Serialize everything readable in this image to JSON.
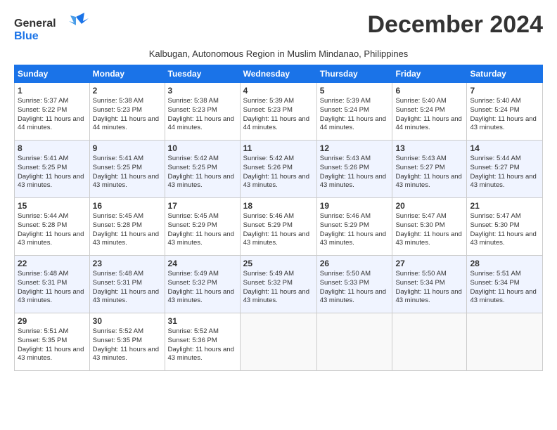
{
  "logo": {
    "line1": "General",
    "line2": "Blue"
  },
  "title": "December 2024",
  "location": "Kalbugan, Autonomous Region in Muslim Mindanao, Philippines",
  "weekdays": [
    "Sunday",
    "Monday",
    "Tuesday",
    "Wednesday",
    "Thursday",
    "Friday",
    "Saturday"
  ],
  "weeks": [
    [
      {
        "day": "1",
        "sunrise": "5:37 AM",
        "sunset": "5:22 PM",
        "daylight": "11 hours and 44 minutes."
      },
      {
        "day": "2",
        "sunrise": "5:38 AM",
        "sunset": "5:23 PM",
        "daylight": "11 hours and 44 minutes."
      },
      {
        "day": "3",
        "sunrise": "5:38 AM",
        "sunset": "5:23 PM",
        "daylight": "11 hours and 44 minutes."
      },
      {
        "day": "4",
        "sunrise": "5:39 AM",
        "sunset": "5:23 PM",
        "daylight": "11 hours and 44 minutes."
      },
      {
        "day": "5",
        "sunrise": "5:39 AM",
        "sunset": "5:24 PM",
        "daylight": "11 hours and 44 minutes."
      },
      {
        "day": "6",
        "sunrise": "5:40 AM",
        "sunset": "5:24 PM",
        "daylight": "11 hours and 44 minutes."
      },
      {
        "day": "7",
        "sunrise": "5:40 AM",
        "sunset": "5:24 PM",
        "daylight": "11 hours and 43 minutes."
      }
    ],
    [
      {
        "day": "8",
        "sunrise": "5:41 AM",
        "sunset": "5:25 PM",
        "daylight": "11 hours and 43 minutes."
      },
      {
        "day": "9",
        "sunrise": "5:41 AM",
        "sunset": "5:25 PM",
        "daylight": "11 hours and 43 minutes."
      },
      {
        "day": "10",
        "sunrise": "5:42 AM",
        "sunset": "5:25 PM",
        "daylight": "11 hours and 43 minutes."
      },
      {
        "day": "11",
        "sunrise": "5:42 AM",
        "sunset": "5:26 PM",
        "daylight": "11 hours and 43 minutes."
      },
      {
        "day": "12",
        "sunrise": "5:43 AM",
        "sunset": "5:26 PM",
        "daylight": "11 hours and 43 minutes."
      },
      {
        "day": "13",
        "sunrise": "5:43 AM",
        "sunset": "5:27 PM",
        "daylight": "11 hours and 43 minutes."
      },
      {
        "day": "14",
        "sunrise": "5:44 AM",
        "sunset": "5:27 PM",
        "daylight": "11 hours and 43 minutes."
      }
    ],
    [
      {
        "day": "15",
        "sunrise": "5:44 AM",
        "sunset": "5:28 PM",
        "daylight": "11 hours and 43 minutes."
      },
      {
        "day": "16",
        "sunrise": "5:45 AM",
        "sunset": "5:28 PM",
        "daylight": "11 hours and 43 minutes."
      },
      {
        "day": "17",
        "sunrise": "5:45 AM",
        "sunset": "5:29 PM",
        "daylight": "11 hours and 43 minutes."
      },
      {
        "day": "18",
        "sunrise": "5:46 AM",
        "sunset": "5:29 PM",
        "daylight": "11 hours and 43 minutes."
      },
      {
        "day": "19",
        "sunrise": "5:46 AM",
        "sunset": "5:29 PM",
        "daylight": "11 hours and 43 minutes."
      },
      {
        "day": "20",
        "sunrise": "5:47 AM",
        "sunset": "5:30 PM",
        "daylight": "11 hours and 43 minutes."
      },
      {
        "day": "21",
        "sunrise": "5:47 AM",
        "sunset": "5:30 PM",
        "daylight": "11 hours and 43 minutes."
      }
    ],
    [
      {
        "day": "22",
        "sunrise": "5:48 AM",
        "sunset": "5:31 PM",
        "daylight": "11 hours and 43 minutes."
      },
      {
        "day": "23",
        "sunrise": "5:48 AM",
        "sunset": "5:31 PM",
        "daylight": "11 hours and 43 minutes."
      },
      {
        "day": "24",
        "sunrise": "5:49 AM",
        "sunset": "5:32 PM",
        "daylight": "11 hours and 43 minutes."
      },
      {
        "day": "25",
        "sunrise": "5:49 AM",
        "sunset": "5:32 PM",
        "daylight": "11 hours and 43 minutes."
      },
      {
        "day": "26",
        "sunrise": "5:50 AM",
        "sunset": "5:33 PM",
        "daylight": "11 hours and 43 minutes."
      },
      {
        "day": "27",
        "sunrise": "5:50 AM",
        "sunset": "5:34 PM",
        "daylight": "11 hours and 43 minutes."
      },
      {
        "day": "28",
        "sunrise": "5:51 AM",
        "sunset": "5:34 PM",
        "daylight": "11 hours and 43 minutes."
      }
    ],
    [
      {
        "day": "29",
        "sunrise": "5:51 AM",
        "sunset": "5:35 PM",
        "daylight": "11 hours and 43 minutes."
      },
      {
        "day": "30",
        "sunrise": "5:52 AM",
        "sunset": "5:35 PM",
        "daylight": "11 hours and 43 minutes."
      },
      {
        "day": "31",
        "sunrise": "5:52 AM",
        "sunset": "5:36 PM",
        "daylight": "11 hours and 43 minutes."
      },
      null,
      null,
      null,
      null
    ]
  ]
}
